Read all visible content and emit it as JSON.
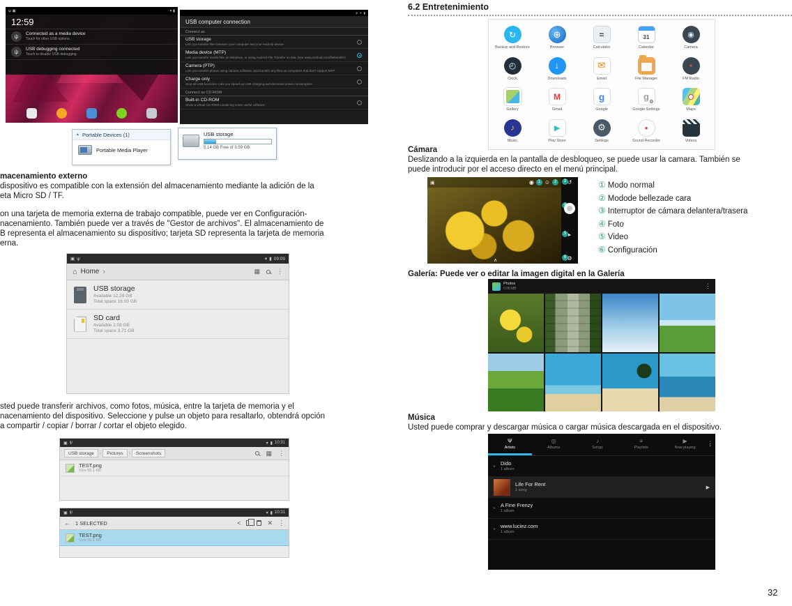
{
  "doc": {
    "section_heading": "6.2 Entretenimiento",
    "page_number": "32",
    "storage_p1": [
      "macenamiento externo",
      "dispositivo es compatible con la extensión del almacenamiento mediante la adición de la",
      "eta Micro SD / TF."
    ],
    "storage_p2": [
      "on una tarjeta de memoria externa de trabajo compatible, puede ver en Configuración-",
      "nacenamiento. También puede ver a través de \"Gestor de archivos\". El almacenamiento de",
      "B representa el almacenamiento su dispositivo; tarjeta SD representa la tarjeta de memoria",
      "erna."
    ],
    "storage_p3": [
      "sted puede transferir archivos, como fotos, música, entre la tarjeta de memoria y el",
      "nacenamiento del dispositivo. Seleccione y pulse un objeto para resaltarlo, obtendrá opción",
      "a compartir / copiar / borrar / cortar el objeto elegido."
    ],
    "camera_heading": "Cámara",
    "camera_body": [
      "Deslizando a la izquierda en la pantalla de desbloqueo, se puede usar la camara. También se",
      "puede introducir por el acceso directo en el menú principal."
    ],
    "camera_legend": [
      {
        "num": "①",
        "text": "Modo normal"
      },
      {
        "num": "②",
        "text": "Modode bellezade cara"
      },
      {
        "num": "③",
        "text": "Interruptor de cámara delantera/trasera"
      },
      {
        "num": "④",
        "text": "Foto"
      },
      {
        "num": "⑤",
        "text": "Video"
      },
      {
        "num": "⑥",
        "text": "Configuración"
      }
    ],
    "gallery_caption": "Galería: Puede ver o editar la imagen digital en la Galería",
    "music_heading": "Música",
    "music_body": "Usted puede comprar y descargar música o cargar música descargada en el dispositivo."
  },
  "lock_screen": {
    "time": "12:59",
    "notifications": [
      {
        "title": "Connected as a media device",
        "subtitle": "Touch for other USB options."
      },
      {
        "title": "USB debugging connected",
        "subtitle": "Touch to disable USB debugging."
      }
    ]
  },
  "usb_screen": {
    "title": "USB computer connection",
    "section1": "Connect as",
    "options": [
      {
        "label": "USB storage",
        "desc": "Lets you transfer files between your computer and your Android device.",
        "selected": false
      },
      {
        "label": "Media device (MTP)",
        "desc": "Lets you transfer media files on Windows, or using Android File Transfer on Mac (see www.android.com/filetransfer)",
        "selected": true
      },
      {
        "label": "Camera (PTP)",
        "desc": "Lets you transfer photos using camera software, and transfer any files on computers that don't support MTP",
        "selected": false
      },
      {
        "label": "Charge only",
        "desc": "Stop all USB functions. Lets you speed up USB charging and decrease power consumption.",
        "selected": false
      }
    ],
    "section2": "Connect as CD-ROM",
    "cdrom_option": {
      "label": "Built-in CD-ROM",
      "desc": "Show a virtual CD-ROM containing some useful software.",
      "selected": false
    }
  },
  "portable_dialog": {
    "title": "Portable Devices (1)",
    "item": "Portable Media Player"
  },
  "usb_storage_dialog": {
    "title": "USB storage",
    "capacity": "5.14 GB Free of 3.59 GB"
  },
  "file_manager_home": {
    "time": "09:09",
    "breadcrumb": "Home",
    "items": [
      {
        "name": "USB storage",
        "available": "Available 12.29 GB",
        "total": "Total space 16.00 GB"
      },
      {
        "name": "SD card",
        "available": "Available 2.08 GB",
        "total": "Total space 3.71 GB"
      }
    ]
  },
  "file_manager_pictures": {
    "time": "10:31",
    "crumbs": [
      "USB storage",
      "Pictures",
      "Screenshots"
    ],
    "file_name": "TEST.png",
    "file_size": "Size 55.1 KB"
  },
  "file_manager_selected": {
    "time": "10:31",
    "selection": "1 SELECTED",
    "file_name": "TEST.png",
    "file_size": "Size 55.1 KB"
  },
  "app_grid": {
    "apps": [
      {
        "label": "Backup and Restore",
        "glyph": "↻"
      },
      {
        "label": "Browser",
        "glyph": "⊕"
      },
      {
        "label": "Calculator",
        "glyph": "="
      },
      {
        "label": "Calendar",
        "glyph": "31"
      },
      {
        "label": "Camera",
        "glyph": "◉"
      },
      {
        "label": "Clock",
        "glyph": "◴"
      },
      {
        "label": "Downloads",
        "glyph": "↓"
      },
      {
        "label": "Email",
        "glyph": "✉"
      },
      {
        "label": "File Manager",
        "glyph": ""
      },
      {
        "label": "FM Radio",
        "glyph": "●"
      },
      {
        "label": "Gallery",
        "glyph": ""
      },
      {
        "label": "Gmail",
        "glyph": "M"
      },
      {
        "label": "Google",
        "glyph": "g"
      },
      {
        "label": "Google Settings",
        "glyph": "g"
      },
      {
        "label": "Maps",
        "glyph": ""
      },
      {
        "label": "Music",
        "glyph": "♪"
      },
      {
        "label": "Play Store",
        "glyph": "▶"
      },
      {
        "label": "Settings",
        "glyph": "⚙"
      },
      {
        "label": "Sound Recorder",
        "glyph": "●"
      },
      {
        "label": "Videos",
        "glyph": ""
      }
    ]
  },
  "camera_screen": {
    "badges": [
      "1",
      "2",
      "3",
      "4",
      "5",
      "6"
    ]
  },
  "gallery_screen": {
    "app_title": "Photos",
    "app_subtitle": "0.00 MB"
  },
  "music_screen": {
    "tabs": [
      {
        "label": "Artists",
        "glyph": "Ψ",
        "selected": true
      },
      {
        "label": "Albums",
        "glyph": "◎",
        "selected": false
      },
      {
        "label": "Songs",
        "glyph": "♪",
        "selected": false
      },
      {
        "label": "Playlists",
        "glyph": "≡",
        "selected": false
      },
      {
        "label": "Now playing",
        "glyph": "▶",
        "selected": false
      }
    ],
    "rows": [
      {
        "title": "Dido",
        "subtitle": "1 album"
      },
      {
        "title": "Life For Rent",
        "subtitle": "1 song"
      },
      {
        "title": "A Fine Frenzy",
        "subtitle": "1 album"
      },
      {
        "title": "www.luciez.com",
        "subtitle": "1 album"
      }
    ]
  },
  "colors": {
    "android_accent": "#33b5e5",
    "selection_highlight": "#a9d9ef",
    "badge_teal": "#2a9d8f"
  }
}
